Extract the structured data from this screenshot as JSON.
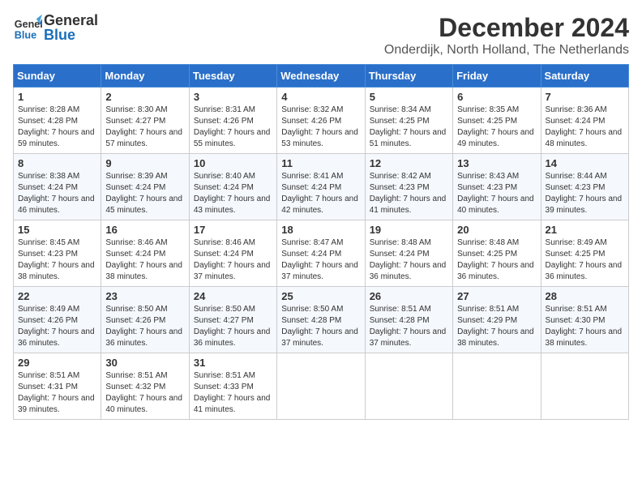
{
  "header": {
    "title": "December 2024",
    "subtitle": "Onderdijk, North Holland, The Netherlands",
    "logo_general": "General",
    "logo_blue": "Blue"
  },
  "calendar": {
    "days_of_week": [
      "Sunday",
      "Monday",
      "Tuesday",
      "Wednesday",
      "Thursday",
      "Friday",
      "Saturday"
    ],
    "weeks": [
      [
        {
          "day": "1",
          "sunrise": "Sunrise: 8:28 AM",
          "sunset": "Sunset: 4:28 PM",
          "daylight": "Daylight: 7 hours and 59 minutes."
        },
        {
          "day": "2",
          "sunrise": "Sunrise: 8:30 AM",
          "sunset": "Sunset: 4:27 PM",
          "daylight": "Daylight: 7 hours and 57 minutes."
        },
        {
          "day": "3",
          "sunrise": "Sunrise: 8:31 AM",
          "sunset": "Sunset: 4:26 PM",
          "daylight": "Daylight: 7 hours and 55 minutes."
        },
        {
          "day": "4",
          "sunrise": "Sunrise: 8:32 AM",
          "sunset": "Sunset: 4:26 PM",
          "daylight": "Daylight: 7 hours and 53 minutes."
        },
        {
          "day": "5",
          "sunrise": "Sunrise: 8:34 AM",
          "sunset": "Sunset: 4:25 PM",
          "daylight": "Daylight: 7 hours and 51 minutes."
        },
        {
          "day": "6",
          "sunrise": "Sunrise: 8:35 AM",
          "sunset": "Sunset: 4:25 PM",
          "daylight": "Daylight: 7 hours and 49 minutes."
        },
        {
          "day": "7",
          "sunrise": "Sunrise: 8:36 AM",
          "sunset": "Sunset: 4:24 PM",
          "daylight": "Daylight: 7 hours and 48 minutes."
        }
      ],
      [
        {
          "day": "8",
          "sunrise": "Sunrise: 8:38 AM",
          "sunset": "Sunset: 4:24 PM",
          "daylight": "Daylight: 7 hours and 46 minutes."
        },
        {
          "day": "9",
          "sunrise": "Sunrise: 8:39 AM",
          "sunset": "Sunset: 4:24 PM",
          "daylight": "Daylight: 7 hours and 45 minutes."
        },
        {
          "day": "10",
          "sunrise": "Sunrise: 8:40 AM",
          "sunset": "Sunset: 4:24 PM",
          "daylight": "Daylight: 7 hours and 43 minutes."
        },
        {
          "day": "11",
          "sunrise": "Sunrise: 8:41 AM",
          "sunset": "Sunset: 4:24 PM",
          "daylight": "Daylight: 7 hours and 42 minutes."
        },
        {
          "day": "12",
          "sunrise": "Sunrise: 8:42 AM",
          "sunset": "Sunset: 4:23 PM",
          "daylight": "Daylight: 7 hours and 41 minutes."
        },
        {
          "day": "13",
          "sunrise": "Sunrise: 8:43 AM",
          "sunset": "Sunset: 4:23 PM",
          "daylight": "Daylight: 7 hours and 40 minutes."
        },
        {
          "day": "14",
          "sunrise": "Sunrise: 8:44 AM",
          "sunset": "Sunset: 4:23 PM",
          "daylight": "Daylight: 7 hours and 39 minutes."
        }
      ],
      [
        {
          "day": "15",
          "sunrise": "Sunrise: 8:45 AM",
          "sunset": "Sunset: 4:23 PM",
          "daylight": "Daylight: 7 hours and 38 minutes."
        },
        {
          "day": "16",
          "sunrise": "Sunrise: 8:46 AM",
          "sunset": "Sunset: 4:24 PM",
          "daylight": "Daylight: 7 hours and 38 minutes."
        },
        {
          "day": "17",
          "sunrise": "Sunrise: 8:46 AM",
          "sunset": "Sunset: 4:24 PM",
          "daylight": "Daylight: 7 hours and 37 minutes."
        },
        {
          "day": "18",
          "sunrise": "Sunrise: 8:47 AM",
          "sunset": "Sunset: 4:24 PM",
          "daylight": "Daylight: 7 hours and 37 minutes."
        },
        {
          "day": "19",
          "sunrise": "Sunrise: 8:48 AM",
          "sunset": "Sunset: 4:24 PM",
          "daylight": "Daylight: 7 hours and 36 minutes."
        },
        {
          "day": "20",
          "sunrise": "Sunrise: 8:48 AM",
          "sunset": "Sunset: 4:25 PM",
          "daylight": "Daylight: 7 hours and 36 minutes."
        },
        {
          "day": "21",
          "sunrise": "Sunrise: 8:49 AM",
          "sunset": "Sunset: 4:25 PM",
          "daylight": "Daylight: 7 hours and 36 minutes."
        }
      ],
      [
        {
          "day": "22",
          "sunrise": "Sunrise: 8:49 AM",
          "sunset": "Sunset: 4:26 PM",
          "daylight": "Daylight: 7 hours and 36 minutes."
        },
        {
          "day": "23",
          "sunrise": "Sunrise: 8:50 AM",
          "sunset": "Sunset: 4:26 PM",
          "daylight": "Daylight: 7 hours and 36 minutes."
        },
        {
          "day": "24",
          "sunrise": "Sunrise: 8:50 AM",
          "sunset": "Sunset: 4:27 PM",
          "daylight": "Daylight: 7 hours and 36 minutes."
        },
        {
          "day": "25",
          "sunrise": "Sunrise: 8:50 AM",
          "sunset": "Sunset: 4:28 PM",
          "daylight": "Daylight: 7 hours and 37 minutes."
        },
        {
          "day": "26",
          "sunrise": "Sunrise: 8:51 AM",
          "sunset": "Sunset: 4:28 PM",
          "daylight": "Daylight: 7 hours and 37 minutes."
        },
        {
          "day": "27",
          "sunrise": "Sunrise: 8:51 AM",
          "sunset": "Sunset: 4:29 PM",
          "daylight": "Daylight: 7 hours and 38 minutes."
        },
        {
          "day": "28",
          "sunrise": "Sunrise: 8:51 AM",
          "sunset": "Sunset: 4:30 PM",
          "daylight": "Daylight: 7 hours and 38 minutes."
        }
      ],
      [
        {
          "day": "29",
          "sunrise": "Sunrise: 8:51 AM",
          "sunset": "Sunset: 4:31 PM",
          "daylight": "Daylight: 7 hours and 39 minutes."
        },
        {
          "day": "30",
          "sunrise": "Sunrise: 8:51 AM",
          "sunset": "Sunset: 4:32 PM",
          "daylight": "Daylight: 7 hours and 40 minutes."
        },
        {
          "day": "31",
          "sunrise": "Sunrise: 8:51 AM",
          "sunset": "Sunset: 4:33 PM",
          "daylight": "Daylight: 7 hours and 41 minutes."
        },
        null,
        null,
        null,
        null
      ]
    ]
  }
}
